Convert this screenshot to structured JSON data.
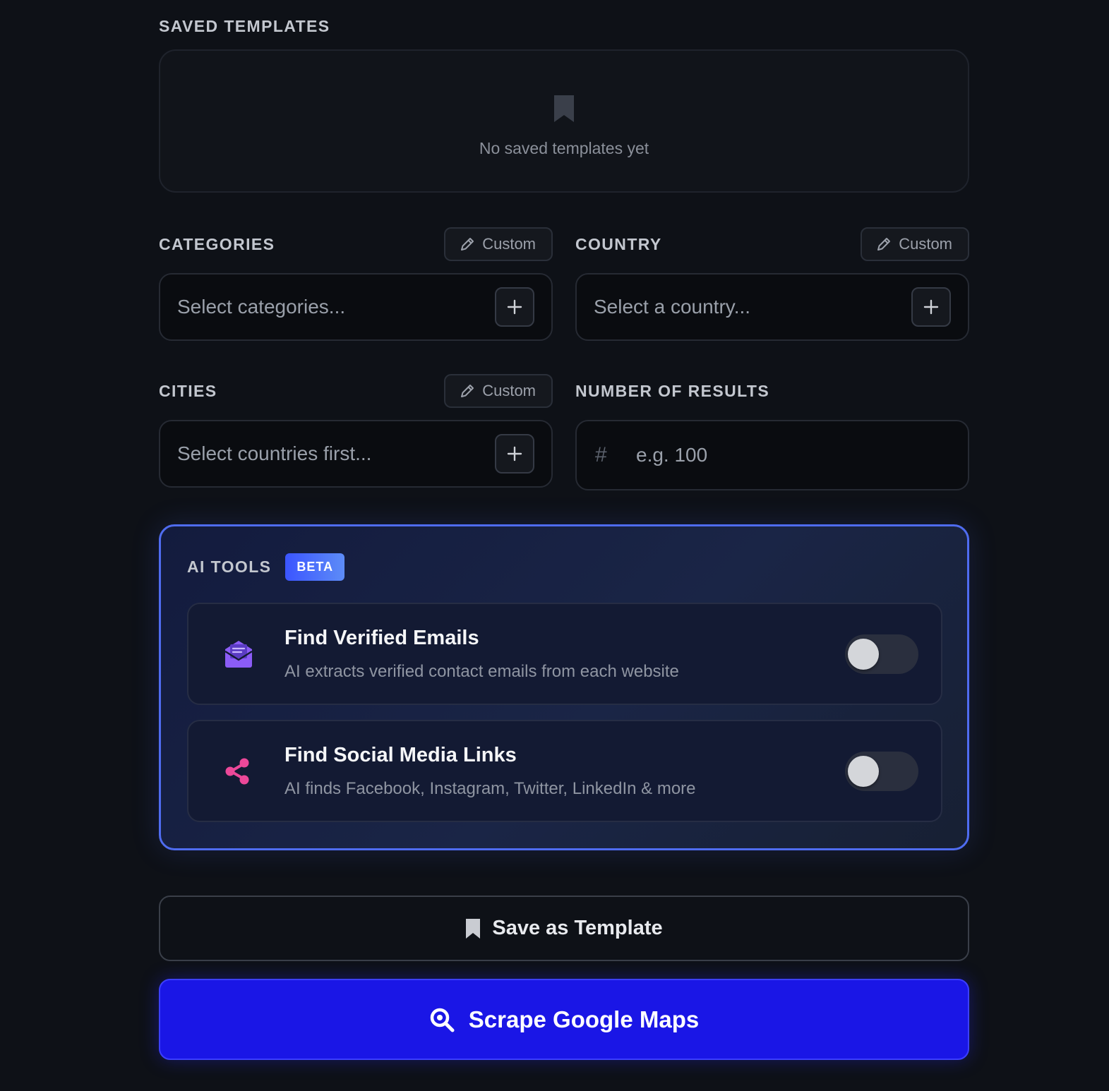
{
  "saved_templates": {
    "label": "SAVED TEMPLATES",
    "empty_text": "No saved templates yet",
    "icon": "bookmark-icon"
  },
  "categories": {
    "label": "CATEGORIES",
    "custom_label": "Custom",
    "placeholder": "Select categories..."
  },
  "country": {
    "label": "COUNTRY",
    "custom_label": "Custom",
    "placeholder": "Select a country..."
  },
  "cities": {
    "label": "CITIES",
    "custom_label": "Custom",
    "placeholder": "Select countries first..."
  },
  "results": {
    "label": "NUMBER OF RESULTS",
    "hash": "#",
    "placeholder": "e.g. 100"
  },
  "ai_tools": {
    "label": "AI TOOLS",
    "badge": "BETA",
    "tools": [
      {
        "title": "Find Verified Emails",
        "description": "AI extracts verified contact emails from each website",
        "icon": "envelope-open-icon",
        "icon_color": "#8b5cf6",
        "enabled": false
      },
      {
        "title": "Find Social Media Links",
        "description": "AI finds Facebook, Instagram, Twitter, LinkedIn & more",
        "icon": "share-icon",
        "icon_color": "#ec4899",
        "enabled": false
      }
    ]
  },
  "actions": {
    "save_template": "Save as Template",
    "scrape": "Scrape Google Maps"
  },
  "colors": {
    "background": "#0e1117",
    "accent": "#1a16e6",
    "panel_border": "#4f6cf0"
  }
}
